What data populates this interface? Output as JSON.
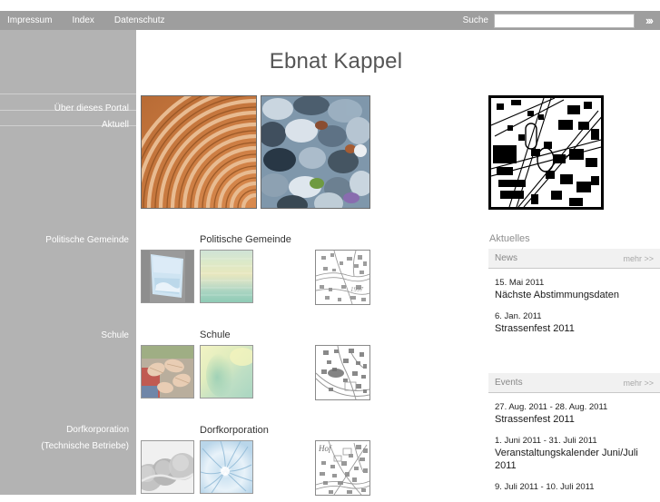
{
  "topbar": {
    "nav": [
      {
        "label": "Impressum",
        "name": "topnav-impressum"
      },
      {
        "label": "Index",
        "name": "topnav-index"
      },
      {
        "label": "Datenschutz",
        "name": "topnav-datenschutz"
      }
    ],
    "search_label": "Suche",
    "search_value": "",
    "search_placeholder": "",
    "submit_icon": "›››"
  },
  "sidebar": {
    "items": [
      {
        "label": "Über dieses Portal"
      },
      {
        "label": "Aktuell"
      },
      {
        "label": "Politische Gemeinde"
      },
      {
        "label": "Schule"
      },
      {
        "label": "Dorfkorporation"
      },
      {
        "label": "(Technische Betriebe)"
      }
    ]
  },
  "main": {
    "title": "Ebnat Kappel",
    "hero": {
      "left_alt": "concentric-rings-photo",
      "right_alt": "river-stones-photo",
      "map_alt": "cadastral-map-thumbnail"
    },
    "sections": [
      {
        "title": "Politische Gemeinde",
        "thumb_a": "window-sky-photo",
        "thumb_b": "green-gradient-photo",
        "map": "map-politische-gemeinde"
      },
      {
        "title": "Schule",
        "thumb_a": "children-hands-photo",
        "thumb_b": "yellow-green-gradient-photo",
        "map": "map-schule"
      },
      {
        "title": "Dorfkorporation",
        "thumb_a": "grey-spheres-photo",
        "thumb_b": "blue-swirl-photo",
        "map": "map-dorfkorporation"
      }
    ]
  },
  "right_column": {
    "heading": "Aktuelles",
    "more_label": "mehr >>",
    "panels": [
      {
        "title": "News",
        "entries": [
          {
            "date": "15. Mai 2011",
            "title": "Nächste Abstimmungsdaten"
          },
          {
            "date": "6. Jan. 2011",
            "title": "Strassenfest 2011"
          }
        ]
      },
      {
        "title": "Events",
        "entries": [
          {
            "date": "27. Aug. 2011 - 28. Aug. 2011",
            "title": "Strassenfest 2011"
          },
          {
            "date": "1. Juni 2011 - 31. Juli 2011",
            "title": "Veranstaltungskalender Juni/Juli 2011"
          },
          {
            "date": "9. Juli 2011 - 10. Juli 2011",
            "title": ""
          }
        ]
      }
    ]
  },
  "colors": {
    "topbar": "#9e9e9e",
    "sidebar": "#b3b3b3",
    "panel_head": "#f1f1f1",
    "title_text": "#555555"
  }
}
